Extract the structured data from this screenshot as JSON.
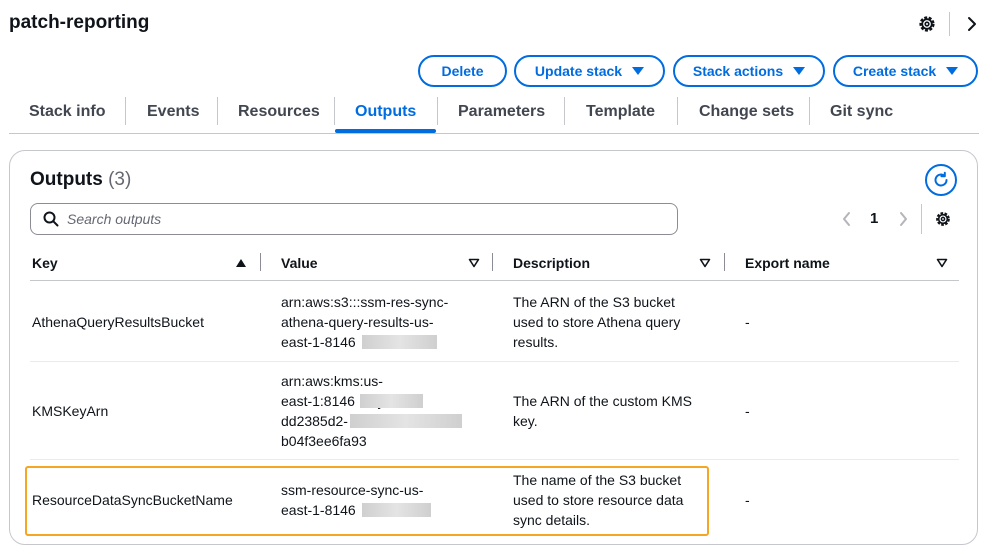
{
  "header": {
    "title": "patch-reporting"
  },
  "actions": {
    "delete": "Delete",
    "update": "Update stack",
    "stack_actions": "Stack actions",
    "create": "Create stack"
  },
  "tabs": [
    "Stack info",
    "Events",
    "Resources",
    "Outputs",
    "Parameters",
    "Template",
    "Change sets",
    "Git sync"
  ],
  "active_tab": "Outputs",
  "outputs": {
    "title": "Outputs",
    "count": "(3)",
    "search_placeholder": "Search outputs",
    "page": "1",
    "columns": {
      "key": "Key",
      "value": "Value",
      "description": "Description",
      "export": "Export name"
    },
    "rows": [
      {
        "key": "AthenaQueryResultsBucket",
        "value": "arn:aws:s3:::ssm-res-sync-\nathena-query-results-us-\neast-1-8146",
        "description": "The ARN of the S3 bucket\nused to store Athena query\nresults.",
        "export": "-"
      },
      {
        "key": "KMSKeyArn",
        "value": "arn:aws:kms:us-\neast-1:8146            :key/\ndd2385d2-                        -\nb04f3ee6fa93",
        "description": "The ARN of the custom KMS\nkey.",
        "export": "-"
      },
      {
        "key": "ResourceDataSyncBucketName",
        "value": "ssm-resource-sync-us-\neast-1-8146",
        "description": "The name of the S3 bucket\nused to store resource data\nsync details.",
        "export": "-"
      }
    ]
  },
  "colors": {
    "accent": "#006ce0",
    "highlight": "#f5a623",
    "border": "#c6c6cd"
  }
}
